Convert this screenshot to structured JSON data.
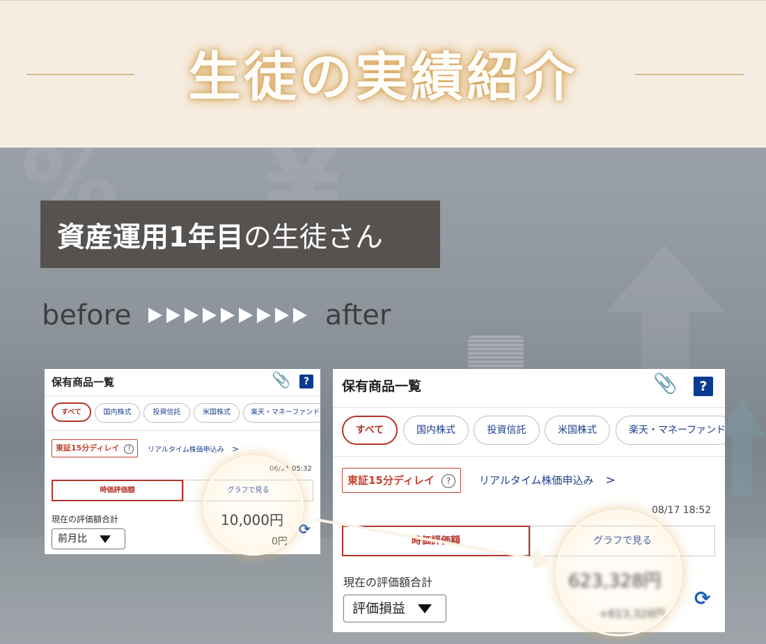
{
  "header": {
    "title": "生徒の実績紹介"
  },
  "student_label": {
    "strong": "資産運用1年目",
    "rest": "の生徒さん"
  },
  "comparison": {
    "before": "before",
    "after": "after"
  },
  "before_card": {
    "title": "保有商品一覧",
    "help": "?",
    "tabs": [
      "すべて",
      "国内株式",
      "投資信託",
      "米国株式",
      "楽天・マネーファンド"
    ],
    "delay_badge": "東証15分ディレイ",
    "realtime_link": "リアルタイム株価申込み",
    "timestamp": "06/21 05:32",
    "segments": [
      "時価評価額",
      "グラフで見る"
    ],
    "eval_label": "現在の評価額合計",
    "select_value": "前月比",
    "total_value": "10,000円",
    "change_value": "0円"
  },
  "after_card": {
    "title": "保有商品一覧",
    "help": "?",
    "tabs": [
      "すべて",
      "国内株式",
      "投資信託",
      "米国株式",
      "楽天・マネーファンド"
    ],
    "delay_badge": "東証15分ディレイ",
    "realtime_link": "リアルタイム株価申込み",
    "timestamp": "08/17 18:52",
    "segments": [
      "時価評価額",
      "グラフで見る"
    ],
    "eval_label": "現在の評価額合計",
    "select_value": "評価損益",
    "total_value_blurred": "623,328円",
    "change_value_blurred": "+613,328円"
  },
  "colors": {
    "accent": "#b3342a",
    "link": "#1c3f8c",
    "label_bg": "#555250",
    "header_bg": "#f6ede2"
  }
}
